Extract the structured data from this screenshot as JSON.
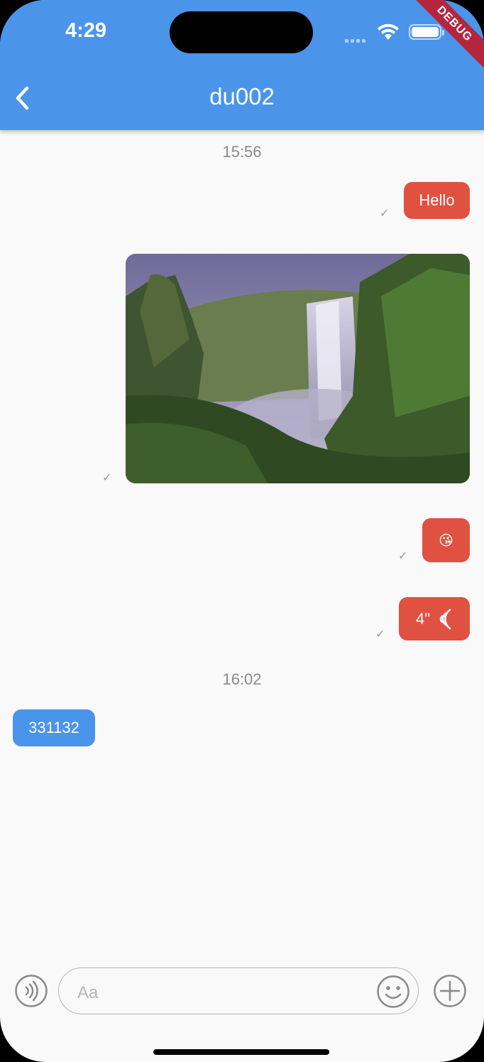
{
  "status_bar": {
    "time": "4:29",
    "debug_label": "DEBUG"
  },
  "header": {
    "title": "du002",
    "back_icon": "chevron-left-icon"
  },
  "messages": {
    "timestamp_1": "15:56",
    "sent_text": "Hello",
    "sent_image": "waterfall-photo",
    "sent_emoji": "😘",
    "sent_voice_duration": "4\"",
    "sent_voice_icon": "voice-wave-icon",
    "timestamp_2": "16:02",
    "received_text": "331132",
    "read_mark": "✓"
  },
  "composer": {
    "placeholder": "Aa",
    "voice_icon": "voice-icon",
    "emoji_icon": "smiley-icon",
    "plus_icon": "plus-circle-icon"
  },
  "colors": {
    "accent": "#4a94ea",
    "sent_bubble": "#e15141",
    "received_bubble": "#4a94ea"
  }
}
